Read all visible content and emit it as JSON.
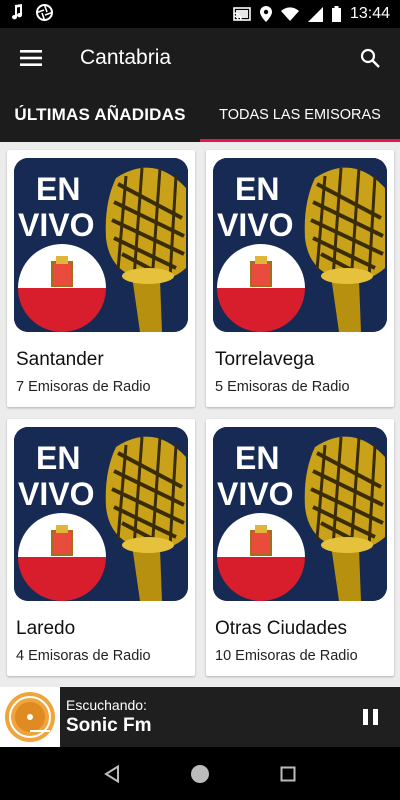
{
  "status_bar": {
    "time": "13:44",
    "left_icons": [
      "music-note-icon",
      "aperture-icon"
    ],
    "right_icons": [
      "cast-icon",
      "location-icon",
      "wifi-icon",
      "signal-icon",
      "battery-icon"
    ]
  },
  "app_bar": {
    "title": "Cantabria",
    "menu_icon": "hamburger-menu-icon",
    "search_icon": "search-icon"
  },
  "tabs": [
    {
      "label": "ÚLTIMAS AÑADIDAS",
      "selected": false
    },
    {
      "label": "TODAS LAS EMISORAS",
      "selected": true
    }
  ],
  "accent_color": "#e8154e",
  "thumbnail": {
    "line1": "EN",
    "line2": "VIVO"
  },
  "cards": [
    {
      "title": "Santander",
      "subtitle": "7 Emisoras de Radio"
    },
    {
      "title": "Torrelavega",
      "subtitle": "5 Emisoras de Radio"
    },
    {
      "title": "Laredo",
      "subtitle": "4 Emisoras de Radio"
    },
    {
      "title": "Otras Ciudades",
      "subtitle": "10 Emisoras de Radio"
    }
  ],
  "player": {
    "label": "Escuchando:",
    "station": "Sonic Fm",
    "state_icon": "pause-icon"
  },
  "nav_bar": [
    "back-icon",
    "home-icon",
    "recents-icon"
  ]
}
